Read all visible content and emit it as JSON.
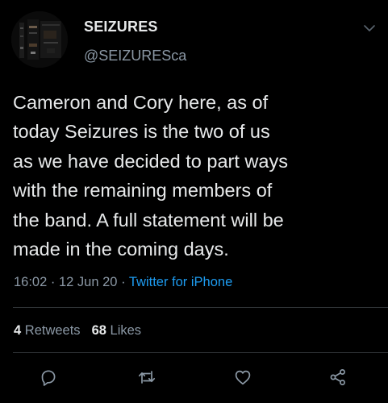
{
  "account": {
    "display_name": "SEIZURES",
    "handle": "@SEIZURESca",
    "avatar_icon": "band-avatar-icon"
  },
  "tweet": {
    "lines": [
      "Cameron and Cory here, as of",
      "today Seizures is the two of us",
      "as we have decided to part ways",
      "with the remaining members of",
      "the band. A full statement will be",
      "made in the coming days."
    ],
    "time": "16:02",
    "date": "12 Jun 20",
    "separator": "·",
    "source": "Twitter for iPhone"
  },
  "stats": {
    "retweets_count": "4",
    "retweets_label": "Retweets",
    "likes_count": "68",
    "likes_label": "Likes"
  },
  "actions": {
    "reply_icon": "reply-icon",
    "retweet_icon": "retweet-icon",
    "like_icon": "heart-icon",
    "share_icon": "share-icon"
  },
  "colors": {
    "background": "#000000",
    "primary_text": "#e7e9ea",
    "secondary_text": "#8b98a5",
    "link": "#1d9bf0",
    "divider": "#2f3336"
  }
}
